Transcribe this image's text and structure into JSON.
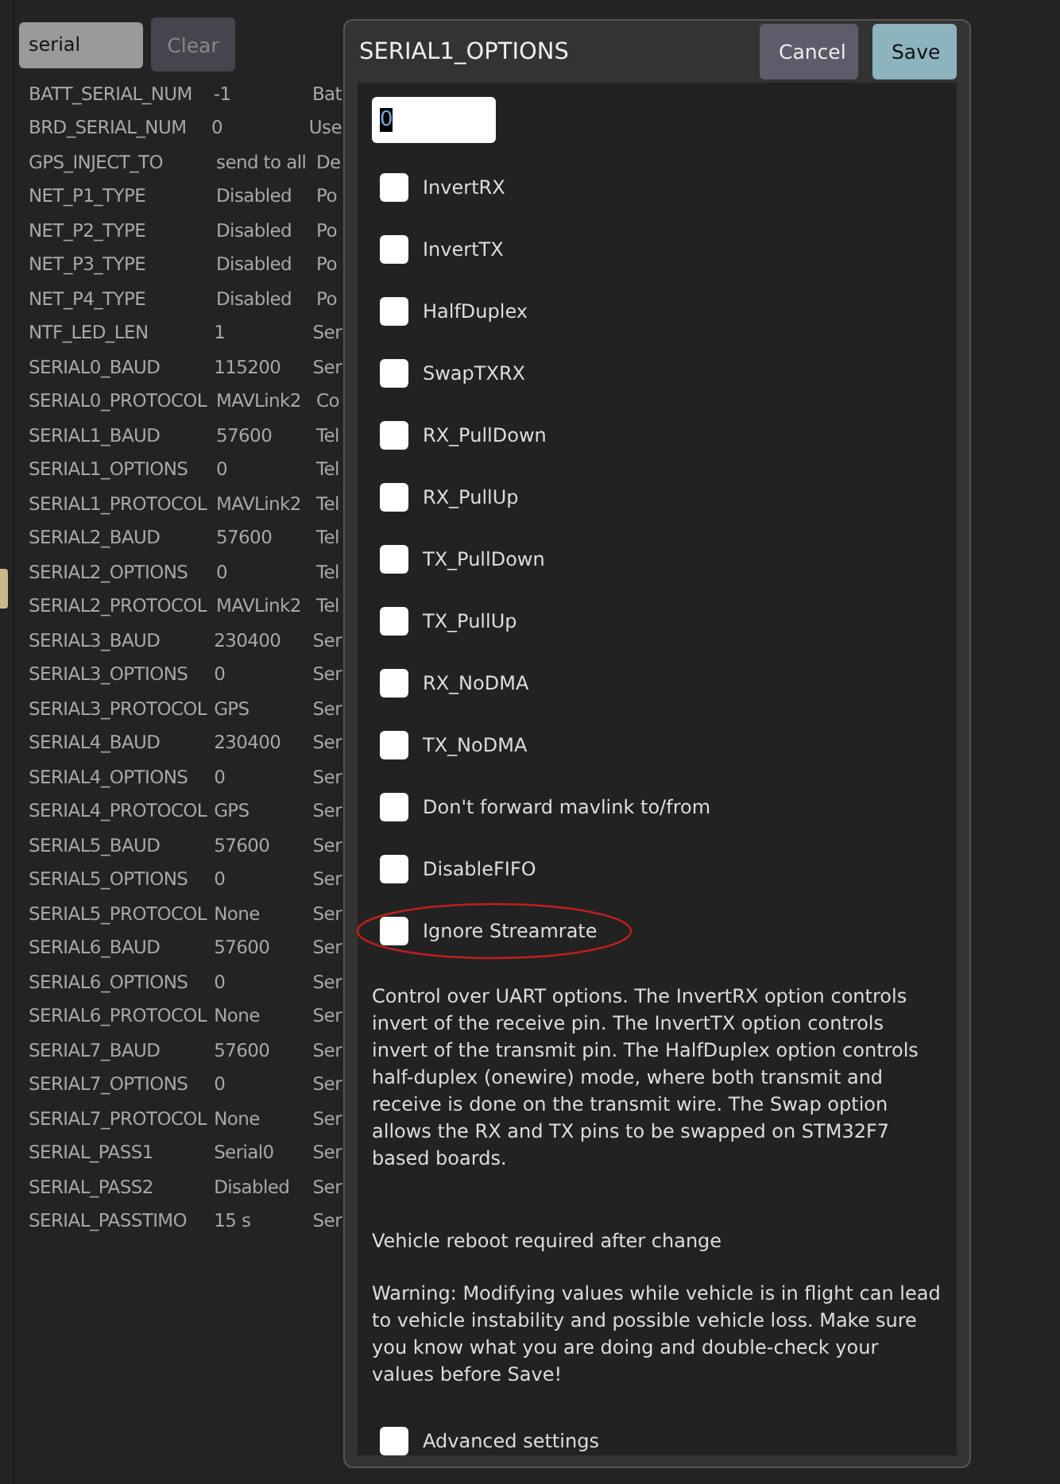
{
  "search": {
    "value": "serial"
  },
  "clear_button": "Clear",
  "params": [
    {
      "name": "BATT_SERIAL_NUM",
      "value": "-1",
      "column_3": "Bat"
    },
    {
      "name": "BRD_SERIAL_NUM",
      "value": "0",
      "column_3": "Use"
    },
    {
      "name": "GPS_INJECT_TO",
      "value": "send to all",
      "column_3": "De"
    },
    {
      "name": "NET_P1_TYPE",
      "value": "Disabled",
      "column_3": "Po"
    },
    {
      "name": "NET_P2_TYPE",
      "value": "Disabled",
      "column_3": "Po"
    },
    {
      "name": "NET_P3_TYPE",
      "value": "Disabled",
      "column_3": "Po"
    },
    {
      "name": "NET_P4_TYPE",
      "value": "Disabled",
      "column_3": "Po"
    },
    {
      "name": "NTF_LED_LEN",
      "value": "1",
      "column_3": "Ser"
    },
    {
      "name": "SERIAL0_BAUD",
      "value": "115200",
      "column_3": "Ser"
    },
    {
      "name": "SERIAL0_PROTOCOL",
      "value": "MAVLink2",
      "column_3": "Co"
    },
    {
      "name": "SERIAL1_BAUD",
      "value": "57600",
      "column_3": "Tel"
    },
    {
      "name": "SERIAL1_OPTIONS",
      "value": "0",
      "column_3": "Tel"
    },
    {
      "name": "SERIAL1_PROTOCOL",
      "value": "MAVLink2",
      "column_3": "Tel"
    },
    {
      "name": "SERIAL2_BAUD",
      "value": "57600",
      "column_3": "Tel"
    },
    {
      "name": "SERIAL2_OPTIONS",
      "value": "0",
      "column_3": "Tel"
    },
    {
      "name": "SERIAL2_PROTOCOL",
      "value": "MAVLink2",
      "column_3": "Tel"
    },
    {
      "name": "SERIAL3_BAUD",
      "value": "230400",
      "column_3": "Ser"
    },
    {
      "name": "SERIAL3_OPTIONS",
      "value": "0",
      "column_3": "Ser"
    },
    {
      "name": "SERIAL3_PROTOCOL",
      "value": "GPS",
      "column_3": "Ser"
    },
    {
      "name": "SERIAL4_BAUD",
      "value": "230400",
      "column_3": "Ser"
    },
    {
      "name": "SERIAL4_OPTIONS",
      "value": "0",
      "column_3": "Ser"
    },
    {
      "name": "SERIAL4_PROTOCOL",
      "value": "GPS",
      "column_3": "Ser"
    },
    {
      "name": "SERIAL5_BAUD",
      "value": "57600",
      "column_3": "Ser"
    },
    {
      "name": "SERIAL5_OPTIONS",
      "value": "0",
      "column_3": "Ser"
    },
    {
      "name": "SERIAL5_PROTOCOL",
      "value": "None",
      "column_3": "Ser"
    },
    {
      "name": "SERIAL6_BAUD",
      "value": "57600",
      "column_3": "Ser"
    },
    {
      "name": "SERIAL6_OPTIONS",
      "value": "0",
      "column_3": "Ser"
    },
    {
      "name": "SERIAL6_PROTOCOL",
      "value": "None",
      "column_3": "Ser"
    },
    {
      "name": "SERIAL7_BAUD",
      "value": "57600",
      "column_3": "Ser"
    },
    {
      "name": "SERIAL7_OPTIONS",
      "value": "0",
      "column_3": "Ser"
    },
    {
      "name": "SERIAL7_PROTOCOL",
      "value": "None",
      "column_3": "Ser"
    },
    {
      "name": "SERIAL_PASS1",
      "value": "Serial0",
      "column_3": "Ser"
    },
    {
      "name": "SERIAL_PASS2",
      "value": "Disabled",
      "column_3": "Ser"
    },
    {
      "name": "SERIAL_PASSTIMO",
      "value": "15 s",
      "column_3": "Ser"
    }
  ],
  "dialog": {
    "title": "SERIAL1_OPTIONS",
    "buttons": [
      {
        "label": "Cancel",
        "kind": "secondary"
      },
      {
        "label": "Save",
        "kind": "primary"
      }
    ],
    "value_field": {
      "value": "0"
    },
    "options": [
      {
        "label": "InvertRX",
        "checked": false,
        "circled": false
      },
      {
        "label": "InvertTX",
        "checked": false,
        "circled": false
      },
      {
        "label": "HalfDuplex",
        "checked": false,
        "circled": false
      },
      {
        "label": "SwapTXRX",
        "checked": false,
        "circled": false
      },
      {
        "label": "RX_PullDown",
        "checked": false,
        "circled": false
      },
      {
        "label": "RX_PullUp",
        "checked": false,
        "circled": false
      },
      {
        "label": "TX_PullDown",
        "checked": false,
        "circled": false
      },
      {
        "label": "TX_PullUp",
        "checked": false,
        "circled": false
      },
      {
        "label": "RX_NoDMA",
        "checked": false,
        "circled": false
      },
      {
        "label": "TX_NoDMA",
        "checked": false,
        "circled": false
      },
      {
        "label": "Don't forward mavlink to/from",
        "checked": false,
        "circled": false
      },
      {
        "label": "DisableFIFO",
        "checked": false,
        "circled": false
      },
      {
        "label": "Ignore Streamrate",
        "checked": false,
        "circled": true
      }
    ],
    "description": "Control over UART options. The InvertRX option controls invert of the receive pin. The InvertTX option controls invert of the transmit pin. The HalfDuplex option controls half-duplex (onewire) mode, where both transmit and receive is done on the transmit wire. The Swap option allows the RX and TX pins to be swapped on STM32F7 based boards.",
    "reboot_note": "Vehicle reboot required after change",
    "warning": "Warning: Modifying values while vehicle is in flight can lead to vehicle instability and possible vehicle loss. Make sure you know what you are doing and double-check your values before Save!",
    "advanced": {
      "label": "Advanced settings",
      "checked": false
    }
  }
}
